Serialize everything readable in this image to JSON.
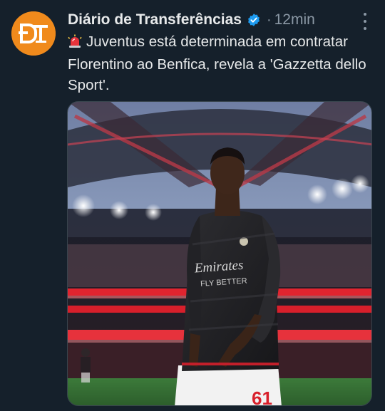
{
  "tweet": {
    "display_name": "Diário de Transferências",
    "separator": "·",
    "time": "12min",
    "text": "Juventus está determinada em contratar Florentino ao Benfica, revela a 'Gazzetta dello Sport'.",
    "emoji_icon": "police-light-icon",
    "avatar_icon": "dt-logo-icon",
    "more_icon": "more-vertical-icon",
    "verified_icon": "verified-badge-icon",
    "media": {
      "sponsor_line1": "Emirates",
      "sponsor_line2": "FLY BETTER",
      "shirt_number": "61"
    }
  },
  "colors": {
    "background": "#15202b",
    "avatar_bg": "#f08a1c",
    "verified": "#1d9bf0",
    "secondary_text": "#8b98a5"
  }
}
